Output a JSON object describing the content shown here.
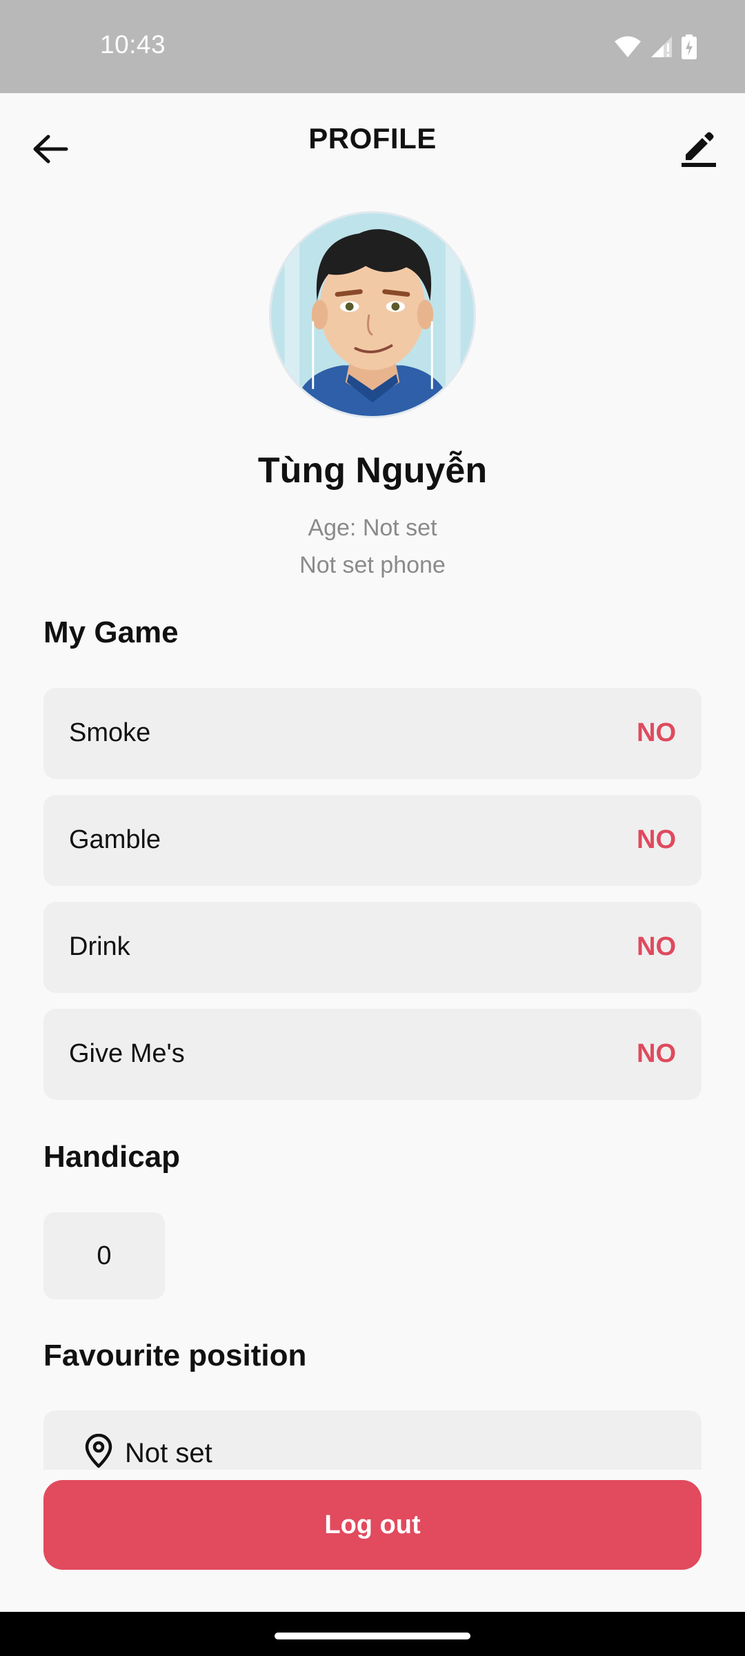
{
  "status_bar": {
    "time": "10:43"
  },
  "header": {
    "title": "PROFILE"
  },
  "profile": {
    "name": "Tùng Nguyễn",
    "age": "Age: Not set",
    "phone": "Not set phone"
  },
  "my_game": {
    "title": "My Game",
    "items": [
      {
        "label": "Smoke",
        "value": "NO"
      },
      {
        "label": "Gamble",
        "value": "NO"
      },
      {
        "label": "Drink",
        "value": "NO"
      },
      {
        "label": "Give Me's",
        "value": "NO"
      }
    ]
  },
  "handicap": {
    "title": "Handicap",
    "value": "0"
  },
  "favourite_position": {
    "title": "Favourite position",
    "value": "Not set"
  },
  "actions": {
    "logout_label": "Log out"
  },
  "colors": {
    "accent": "#E24A5E",
    "status_bar": "#B8B8B8",
    "card": "#EFEFEF"
  },
  "icons": [
    "back-arrow-icon",
    "edit-pencil-icon",
    "wifi-icon",
    "signal-icon",
    "battery-icon",
    "location-pin-icon"
  ]
}
